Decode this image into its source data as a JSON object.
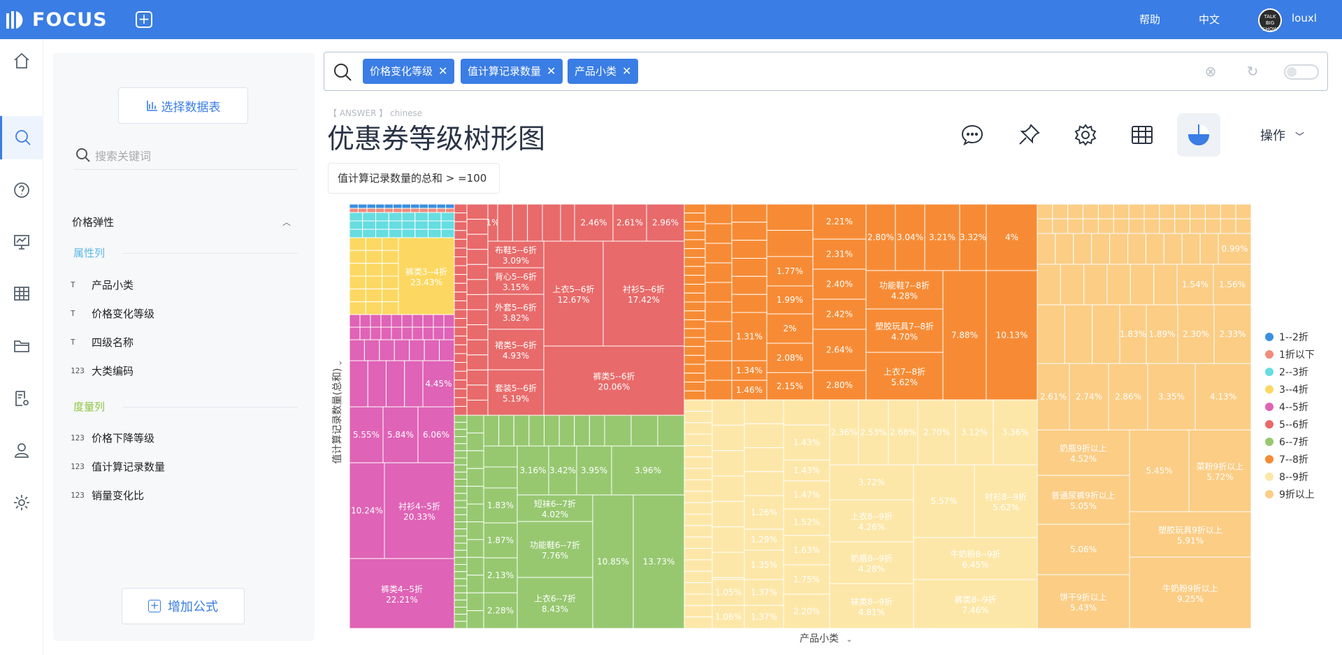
{
  "app": {
    "name": "FOCUS",
    "help": "帮助",
    "lang": "中文",
    "user": "louxl",
    "avatar_text": "TALK BIG SHOW"
  },
  "sidebar": {
    "select_table": "选择数据表",
    "search_placeholder": "搜索关键词",
    "group": "价格弹性",
    "attr_title": "属性列",
    "attr_fields": [
      {
        "icon": "T",
        "label": "产品小类"
      },
      {
        "icon": "T",
        "label": "价格变化等级"
      },
      {
        "icon": "T",
        "label": "四级名称"
      },
      {
        "icon": "123",
        "label": "大类编码"
      }
    ],
    "measure_title": "度量列",
    "measure_fields": [
      {
        "icon": "123",
        "label": "价格下降等级"
      },
      {
        "icon": "123",
        "label": "值计算记录数量"
      },
      {
        "icon": "123",
        "label": "销量变化比"
      }
    ],
    "add_formula": "增加公式"
  },
  "search": {
    "chips": [
      "价格变化等级",
      "值计算记录数量",
      "产品小类"
    ]
  },
  "answer": {
    "label": "【 ANSWER 】 chinese",
    "title": "优惠券等级树形图",
    "operations": "操作",
    "filter": "值计算记录数量的总和 > =100"
  },
  "colors": {
    "primary": "#3a7de4",
    "1--2折": "#3a8fe0",
    "1折以下": "#f08c7c",
    "2--3折": "#66dde0",
    "3--4折": "#fcd862",
    "4--5折": "#df63b6",
    "5--6折": "#e86a6a",
    "6--7折": "#97c870",
    "7--8折": "#f78b35",
    "8--9折": "#fde7a8",
    "9折以上": "#fbcd85"
  },
  "chart_data": {
    "type": "treemap",
    "title": "优惠券等级树形图",
    "xlabel": "产品小类",
    "ylabel": "值计算记录数量(总和)",
    "legend": {
      "position": "right",
      "items": [
        "1--2折",
        "1折以下",
        "2--3折",
        "3--4折",
        "4--5折",
        "5--6折",
        "6--7折",
        "7--8折",
        "8--9折",
        "9折以上"
      ]
    },
    "groups": [
      {
        "name": "3--4折",
        "labeled_leaves": [
          {
            "label": "裤类3--4折",
            "value": "23.43%"
          }
        ]
      },
      {
        "name": "4--5折",
        "labeled_leaves": [
          {
            "label": "",
            "value": "4.45%"
          },
          {
            "label": "",
            "value": "5.55%"
          },
          {
            "label": "",
            "value": "5.84%"
          },
          {
            "label": "",
            "value": "6.06%"
          },
          {
            "label": "",
            "value": "10.24%"
          },
          {
            "label": "衬衫4--5折",
            "value": "20.33%"
          },
          {
            "label": "裤类4--5折",
            "value": "22.21%"
          }
        ]
      },
      {
        "name": "5--6折",
        "labeled_leaves": [
          {
            "label": "",
            "value": "1%"
          },
          {
            "label": "",
            "value": "2.46%"
          },
          {
            "label": "",
            "value": "2.61%"
          },
          {
            "label": "",
            "value": "2.96%"
          },
          {
            "label": "布鞋5--6折",
            "value": "3.09%"
          },
          {
            "label": "背心5--6折",
            "value": "3.15%"
          },
          {
            "label": "外套5--6折",
            "value": "3.82%"
          },
          {
            "label": "裙类5--6折",
            "value": "4.93%"
          },
          {
            "label": "套装5--6折",
            "value": "5.19%"
          },
          {
            "label": "上衣5--6折",
            "value": "12.67%"
          },
          {
            "label": "衬衫5--6折",
            "value": "17.42%"
          },
          {
            "label": "裤类5--6折",
            "value": "20.06%"
          }
        ]
      },
      {
        "name": "6--7折",
        "labeled_leaves": [
          {
            "label": "",
            "value": "3.16%"
          },
          {
            "label": "",
            "value": "3.42%"
          },
          {
            "label": "",
            "value": "3.95%"
          },
          {
            "label": "",
            "value": "3.96%"
          },
          {
            "label": "短袜6--7折",
            "value": "4.02%"
          },
          {
            "label": "",
            "value": "1.83%"
          },
          {
            "label": "",
            "value": "1.87%"
          },
          {
            "label": "",
            "value": "2.13%"
          },
          {
            "label": "",
            "value": "2.28%"
          },
          {
            "label": "功能鞋6--7折",
            "value": "7.76%"
          },
          {
            "label": "上衣6--7折",
            "value": "8.43%"
          },
          {
            "label": "",
            "value": "10.85%"
          },
          {
            "label": "",
            "value": "13.73%"
          }
        ]
      },
      {
        "name": "7--8折",
        "labeled_leaves": [
          {
            "label": "",
            "value": "2.21%"
          },
          {
            "label": "",
            "value": "2.31%"
          },
          {
            "label": "",
            "value": "2.40%"
          },
          {
            "label": "",
            "value": "2.42%"
          },
          {
            "label": "",
            "value": "2.64%"
          },
          {
            "label": "",
            "value": "2.80%"
          },
          {
            "label": "",
            "value": "1.77%"
          },
          {
            "label": "",
            "value": "1.99%"
          },
          {
            "label": "",
            "value": "2%"
          },
          {
            "label": "",
            "value": "2.08%"
          },
          {
            "label": "",
            "value": "2.15%"
          },
          {
            "label": "",
            "value": "1.31%"
          },
          {
            "label": "",
            "value": "1.34%"
          },
          {
            "label": "",
            "value": "1.46%"
          },
          {
            "label": "",
            "value": "2.80%"
          },
          {
            "label": "",
            "value": "3.04%"
          },
          {
            "label": "",
            "value": "3.21%"
          },
          {
            "label": "",
            "value": "3.32%"
          },
          {
            "label": "",
            "value": "4%"
          },
          {
            "label": "功能鞋7--8折",
            "value": "4.28%"
          },
          {
            "label": "塑胶玩具7--8折",
            "value": "4.70%"
          },
          {
            "label": "上衣7--8折",
            "value": "5.62%"
          },
          {
            "label": "",
            "value": "7.88%"
          },
          {
            "label": "",
            "value": "10.13%"
          }
        ]
      },
      {
        "name": "8--9折",
        "labeled_leaves": [
          {
            "label": "",
            "value": "1.43%"
          },
          {
            "label": "",
            "value": "1.43%"
          },
          {
            "label": "",
            "value": "1.47%"
          },
          {
            "label": "",
            "value": "1.52%"
          },
          {
            "label": "",
            "value": "1.63%"
          },
          {
            "label": "",
            "value": "1.75%"
          },
          {
            "label": "",
            "value": "2.20%"
          },
          {
            "label": "",
            "value": "1.26%"
          },
          {
            "label": "",
            "value": "1.29%"
          },
          {
            "label": "",
            "value": "1.35%"
          },
          {
            "label": "",
            "value": "1.37%"
          },
          {
            "label": "",
            "value": "1.37%"
          },
          {
            "label": "",
            "value": "1.05%"
          },
          {
            "label": "",
            "value": "1.06%"
          },
          {
            "label": "",
            "value": "2.36%"
          },
          {
            "label": "",
            "value": "2.53%"
          },
          {
            "label": "",
            "value": "2.68%"
          },
          {
            "label": "",
            "value": "2.70%"
          },
          {
            "label": "",
            "value": "3.12%"
          },
          {
            "label": "",
            "value": "3.36%"
          },
          {
            "label": "",
            "value": "3.72%"
          },
          {
            "label": "上衣8--9折",
            "value": "4.26%"
          },
          {
            "label": "奶瓶8--9折",
            "value": "4.28%"
          },
          {
            "label": "袜类8--9折",
            "value": "4.81%"
          },
          {
            "label": "",
            "value": "5.57%"
          },
          {
            "label": "衬衫8--9折",
            "value": "5.62%"
          },
          {
            "label": "牛奶粉8--9折",
            "value": "6.45%"
          },
          {
            "label": "裤类8--9折",
            "value": "7.46%"
          }
        ]
      },
      {
        "name": "9折以上",
        "labeled_leaves": [
          {
            "label": "",
            "value": "0.99%"
          },
          {
            "label": "",
            "value": "1.54%"
          },
          {
            "label": "",
            "value": "1.56%"
          },
          {
            "label": "",
            "value": "1.83%"
          },
          {
            "label": "",
            "value": "1.89%"
          },
          {
            "label": "",
            "value": "2.30%"
          },
          {
            "label": "",
            "value": "2.33%"
          },
          {
            "label": "",
            "value": "2.61%"
          },
          {
            "label": "",
            "value": "2.74%"
          },
          {
            "label": "",
            "value": "2.86%"
          },
          {
            "label": "",
            "value": "3.35%"
          },
          {
            "label": "",
            "value": "4.13%"
          },
          {
            "label": "奶瓶9折以上",
            "value": "4.52%"
          },
          {
            "label": "",
            "value": "5.45%"
          },
          {
            "label": "菜粉9折以上",
            "value": "5.72%"
          },
          {
            "label": "普通尿裤9折以上",
            "value": "5.05%"
          },
          {
            "label": "",
            "value": "5.06%"
          },
          {
            "label": "塑胶玩具9折以上",
            "value": "5.91%"
          },
          {
            "label": "饼干9折以上",
            "value": "5.43%"
          },
          {
            "label": "牛奶粉9折以上",
            "value": "9.25%"
          }
        ]
      }
    ]
  }
}
